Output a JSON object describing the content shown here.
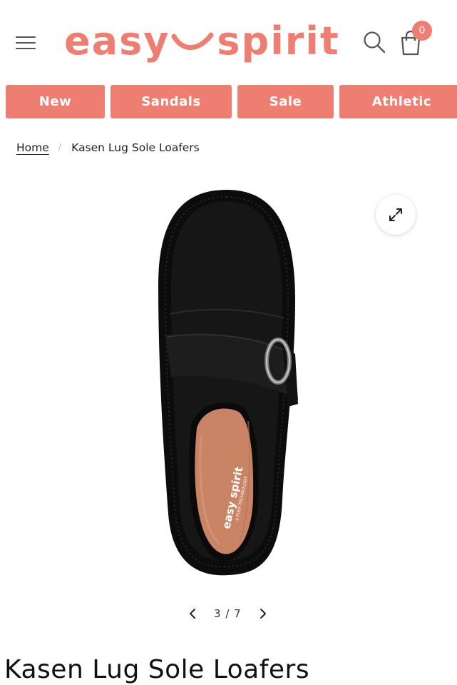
{
  "header": {
    "logo_left": "easy",
    "logo_right": "spirit",
    "cart_count": "0"
  },
  "nav": {
    "items": [
      {
        "label": "New"
      },
      {
        "label": "Sandals"
      },
      {
        "label": "Sale"
      },
      {
        "label": "Athletic"
      }
    ]
  },
  "breadcrumb": {
    "home": "Home",
    "separator": "/",
    "current": "Kasen Lug Sole Loafers"
  },
  "gallery": {
    "insole_brand": "easy spirit",
    "insole_tagline": "e FLEX TECHNOLOGY",
    "current": "3",
    "separator": "/",
    "total": "7"
  },
  "product": {
    "title": "Kasen Lug Sole Loafers"
  },
  "colors": {
    "brand": "#ee7d72",
    "shoe": "#111111",
    "insole": "#c98466"
  }
}
